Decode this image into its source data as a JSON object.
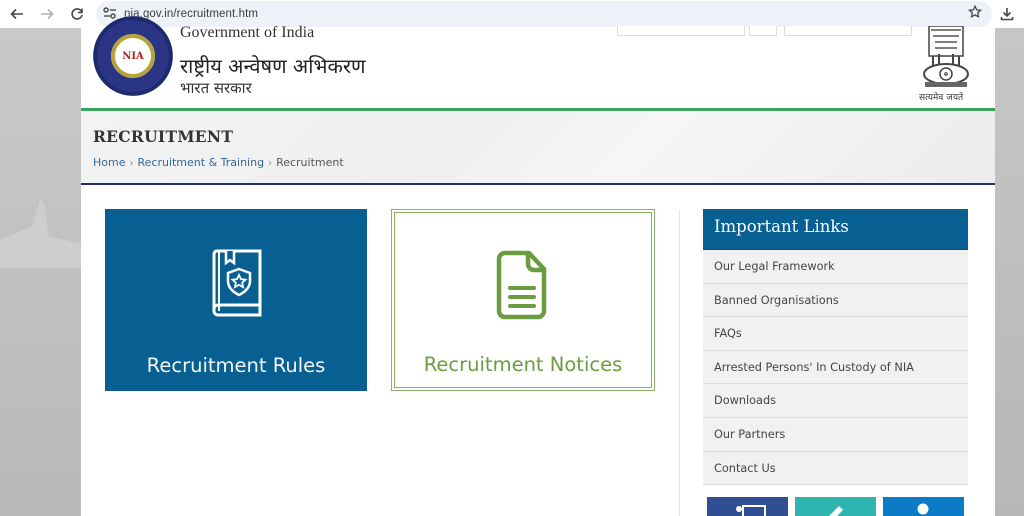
{
  "browser": {
    "url": "nia.gov.in/recruitment.htm",
    "icons": {
      "back": "arrow-left-icon",
      "forward": "arrow-right-icon",
      "reload": "reload-icon",
      "site_info": "tune-icon",
      "bookmark": "star-icon",
      "download": "download-icon"
    }
  },
  "header": {
    "title_en": "Government of India",
    "title_hi": "राष्ट्रीय अन्वेषण अभिकरण",
    "subtitle_hi": "भारत सरकार",
    "logo_text": "NIA",
    "emblem_motto": "सत्यमेव जयते"
  },
  "title_band": {
    "title": "RECRUITMENT",
    "breadcrumb": [
      {
        "label": "Home",
        "link": true
      },
      {
        "label": "Recruitment & Training",
        "link": true
      },
      {
        "label": "Recruitment",
        "link": false
      }
    ],
    "separator": "›"
  },
  "tiles": [
    {
      "label": "Recruitment Rules",
      "icon": "rule-book-icon",
      "color": "#075f92"
    },
    {
      "label": "Recruitment Notices",
      "icon": "document-icon",
      "color": "#6a9d3f"
    }
  ],
  "sidebar": {
    "heading": "Important Links",
    "items": [
      {
        "label": "Our Legal Framework"
      },
      {
        "label": "Banned Organisations"
      },
      {
        "label": "FAQs"
      },
      {
        "label": "Arrested Persons' In Custody of NIA"
      },
      {
        "label": "Downloads"
      },
      {
        "label": "Our Partners"
      },
      {
        "label": "Contact Us"
      }
    ],
    "quick_tiles": [
      {
        "icon": "presentation-icon",
        "color": "#2f4e93"
      },
      {
        "icon": "pencil-icon",
        "color": "#2fb5b0"
      },
      {
        "icon": "user-icon",
        "color": "#0b7bc8"
      }
    ]
  }
}
